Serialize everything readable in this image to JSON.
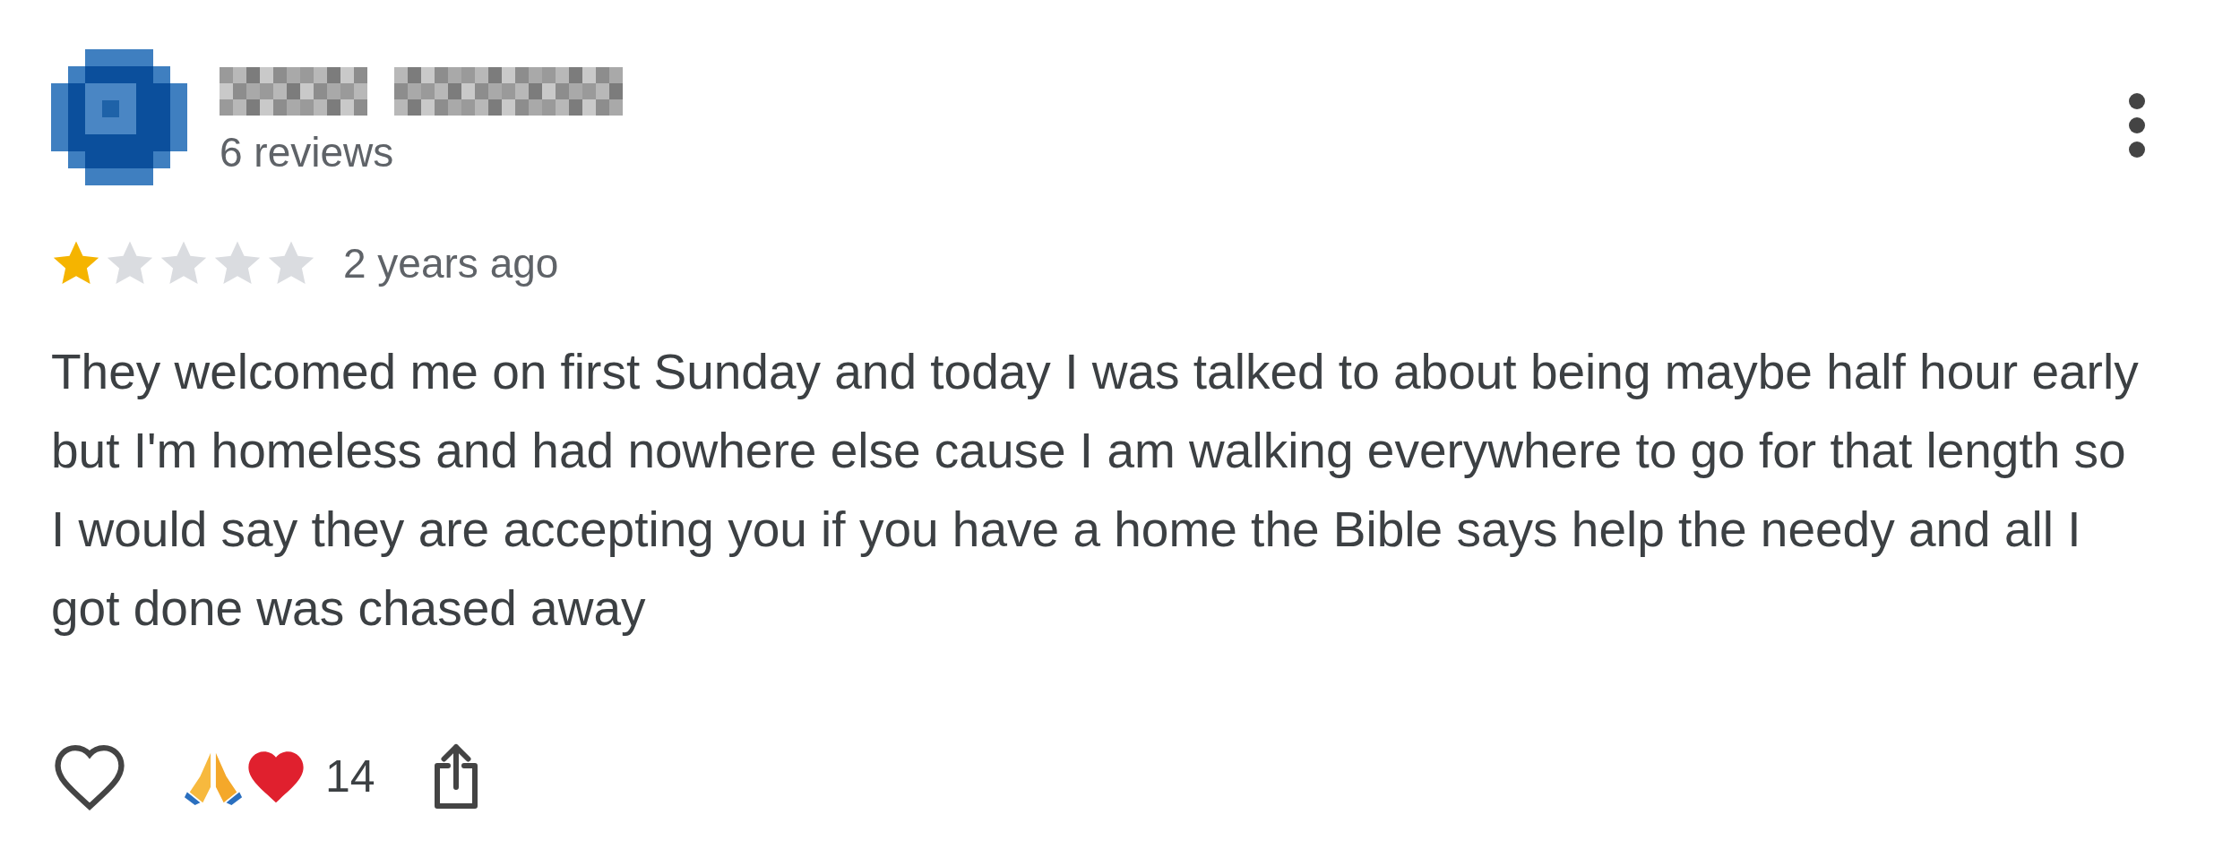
{
  "review": {
    "reviewer_meta": "6 reviews",
    "stars": 1,
    "time": "2 years ago",
    "text": "They welcomed me on first Sunday and today I was talked to about being maybe half hour early but I'm homeless and had nowhere else cause I am walking everywhere to go for that length so I would say they are accepting you if you have a home the Bible says help the needy and all I got done was chased away",
    "liked": false,
    "reaction_count": "14"
  }
}
